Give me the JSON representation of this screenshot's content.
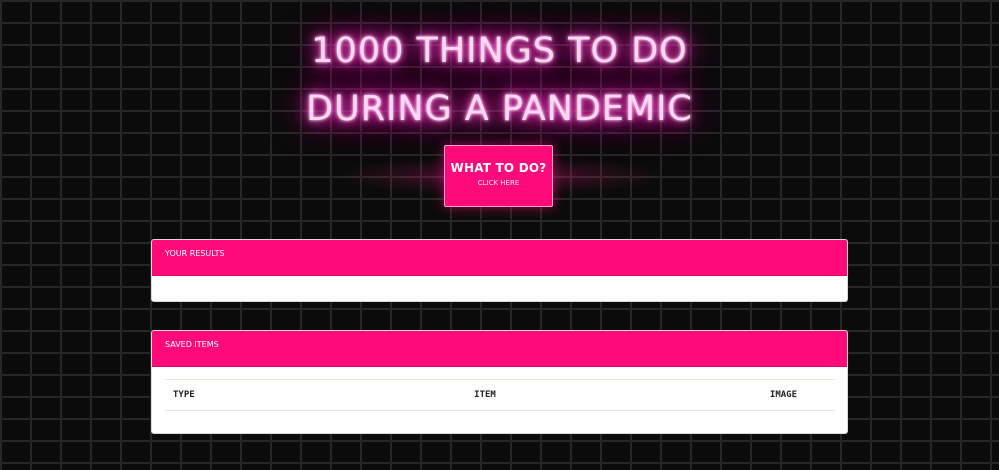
{
  "header": {
    "title_line1": "1000 THINGS TO DO",
    "title_line2": "DURING A PANDEMIC"
  },
  "cta": {
    "label": "WHAT TO DO?",
    "sublabel": "CLICK HERE"
  },
  "results_panel": {
    "title": "YOUR RESULTS"
  },
  "saved_panel": {
    "title": "SAVED ITEMS",
    "columns": [
      "TYPE",
      "ITEM",
      "IMAGE"
    ]
  },
  "colors": {
    "accent": "#ff0a7a",
    "neon_glow": "#ff2fc2",
    "background": "#0b0b0b",
    "brick_lines": "#262626"
  }
}
